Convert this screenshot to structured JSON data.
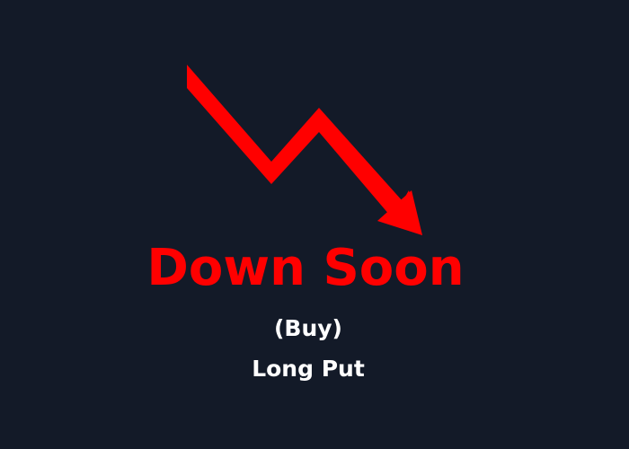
{
  "colors": {
    "background": "#131a28",
    "accent": "#ff0000",
    "text": "#ffffff"
  },
  "graphic": {
    "icon": "down-trend-arrow-icon"
  },
  "headline": "Down Soon",
  "action": "(Buy)",
  "strategy": "Long Put"
}
